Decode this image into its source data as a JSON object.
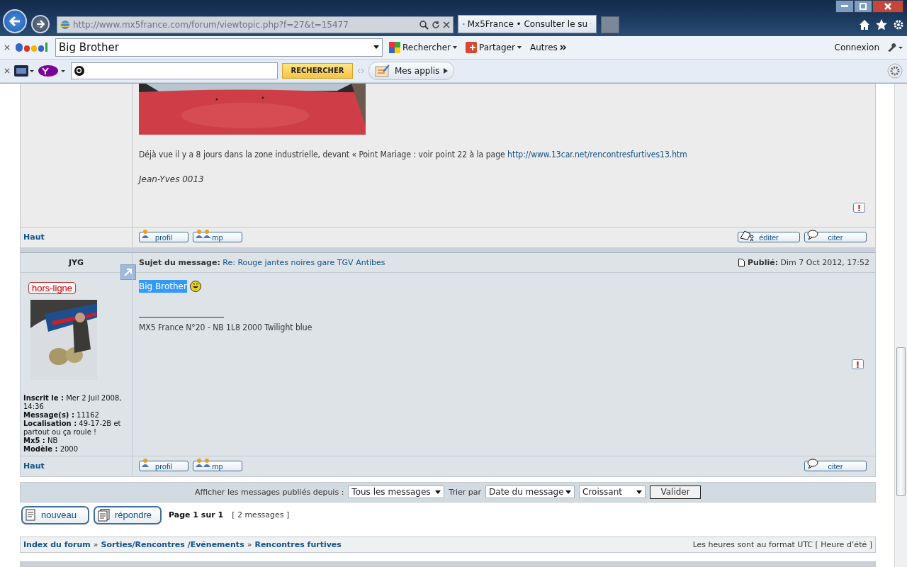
{
  "browser": {
    "address": "http://www.mx5france.com/forum/viewtopic.php?f=27&t=15477",
    "tab_title": "Mx5France • Consulter le su"
  },
  "google_toolbar": {
    "search_value": "Big Brother",
    "buttons": [
      {
        "kind": "search",
        "label": "Rechercher"
      },
      {
        "kind": "share",
        "label": "Partager"
      },
      {
        "kind": "more",
        "label": "Autres"
      }
    ],
    "signin": "Connexion"
  },
  "yahoo_toolbar": {
    "search_button": "RECHERCHER",
    "apps": "Mes applis"
  },
  "posts": [
    {
      "paragraph": "Déjà vue il y a 8 jours dans la zone industrielle, devant « Point Mariage : voir point 22 à la page ",
      "link": "http://www.13car.net/rencontresfurtives13.htm",
      "signature": "Jean-Yves 0013",
      "top": "Haut",
      "buttons": [
        {
          "kind": "profile",
          "label": "profil"
        },
        {
          "kind": "pm",
          "label": "mp"
        }
      ],
      "right_buttons": [
        {
          "kind": "edit",
          "label": "éditer"
        },
        {
          "kind": "quote",
          "label": "citer"
        }
      ]
    },
    {
      "author": "JYG",
      "subject_label": "Sujet du message:",
      "subject": "Re: Rouge jantes noires gare TGV Antibes",
      "published_label": "Publié:",
      "date": "Dim 7 Oct 2012, 17:52",
      "status": "hors-ligne",
      "profile": [
        "**Inscrit le :** Mer 2 Juil 2008, 14:36",
        "**Message(s) :** 11162",
        "**Localisation :** 49-17-2B et partout ou ça roule !",
        "**Mx5 :** NB",
        "**Modèle :** 2000"
      ],
      "greeting": {
        "text": "Big Brother",
        "selected": true
      },
      "signature": "MX5 France N°20 - NB 1L8 2000 Twilight blue",
      "top": "Haut",
      "buttons": [
        {
          "kind": "profile",
          "label": "profil"
        },
        {
          "kind": "pm",
          "label": "mp"
        }
      ],
      "right_buttons": [
        {
          "kind": "quote",
          "label": "citer"
        }
      ]
    }
  ],
  "sort_bar": {
    "label": "Afficher les messages publiés depuis :",
    "period": "Tous les messages",
    "sort_label": "Trier par",
    "sort_by": "Date du message",
    "order": "Croissant",
    "submit": "Valider"
  },
  "actions": [
    {
      "kind": "new",
      "label": "nouveau"
    },
    {
      "kind": "reply",
      "label": "répondre"
    }
  ],
  "pagination": {
    "page": "Page 1 sur 1",
    "count": "[ 2 messages ]"
  },
  "breadcrumb": {
    "items": [
      "Index du forum",
      "Sorties/Rencontres /Evénements",
      "Rencontres furtives"
    ],
    "separators": [
      "»",
      "»"
    ],
    "timezone": "Les heures sont au format UTC [ Heure d’été ]"
  }
}
